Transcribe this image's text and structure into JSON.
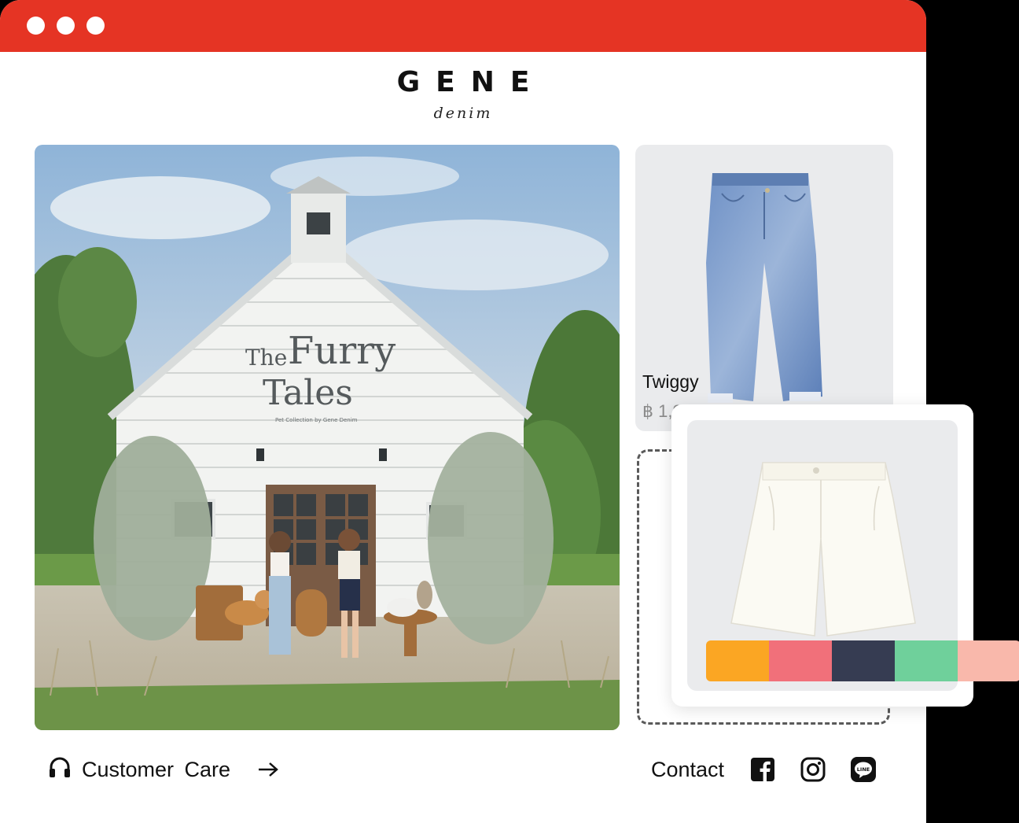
{
  "window": {
    "accent_color": "#e53424"
  },
  "brand": {
    "name": "GENE",
    "subtitle": "denim"
  },
  "hero": {
    "image": "campaign photo of a white wooden farmhouse with two women, dogs and cats",
    "sign_title_small": "The",
    "sign_title_large": "Furry",
    "sign_title_second": "Tales",
    "sign_caption": "Pet Collection by Gene Denim"
  },
  "product": {
    "name": "Twiggy",
    "price": "฿ 1,9",
    "image": "light-wash blue straight jeans"
  },
  "floating_product": {
    "image": "white high-waist shorts",
    "swatches": [
      "#fba623",
      "#f1707a",
      "#363c52",
      "#6fd09b",
      "#f9b8ab"
    ]
  },
  "footer": {
    "customer_care_label": "Customer  Care",
    "contact_label": "Contact",
    "icons": [
      "headset-icon",
      "arrow-right-icon",
      "facebook-icon",
      "instagram-icon",
      "line-icon"
    ]
  }
}
